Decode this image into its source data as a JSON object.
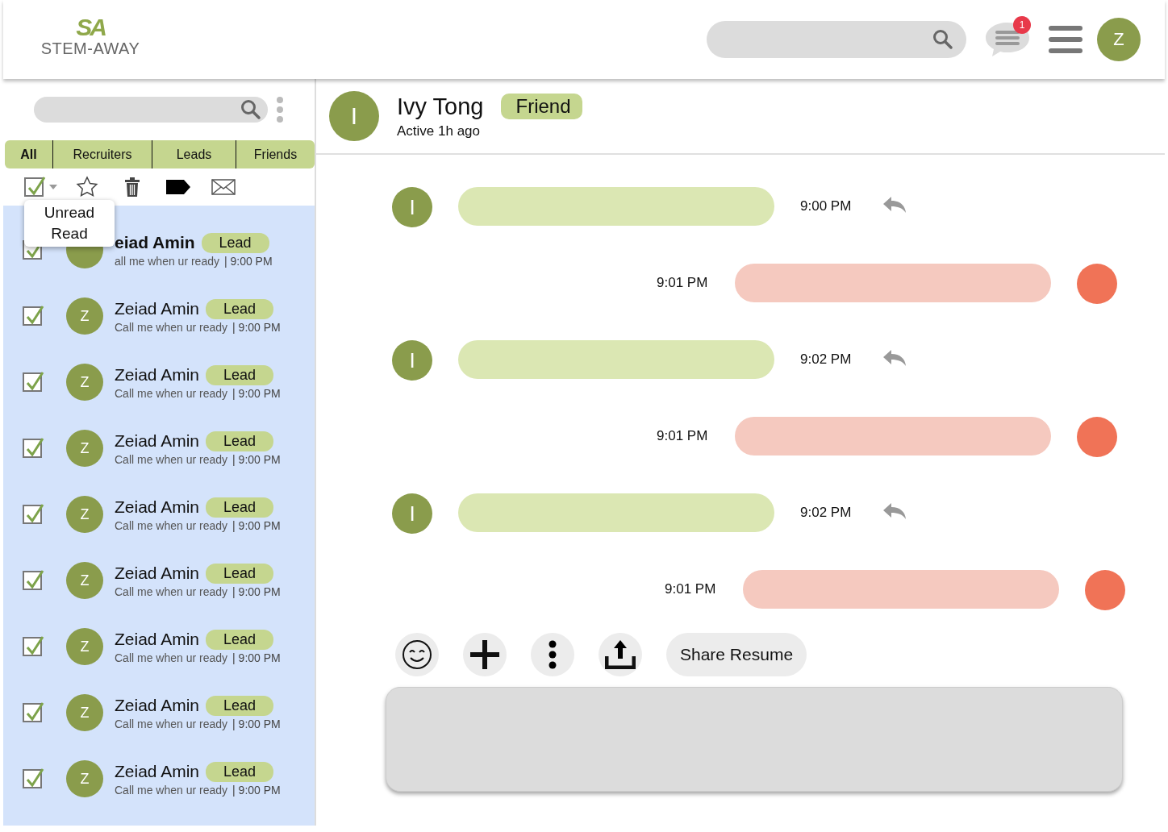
{
  "header": {
    "logo": {
      "initials": "SA",
      "name": "STEM-AWAY"
    },
    "notifications": {
      "badge": "1"
    },
    "user_avatar": "Z"
  },
  "sidebar": {
    "tabs": [
      {
        "label": "All",
        "selected": true
      },
      {
        "label": "Recruiters",
        "selected": false
      },
      {
        "label": "Leads",
        "selected": false
      },
      {
        "label": "Friends",
        "selected": false
      }
    ],
    "select_all_checked": true,
    "select_menu": [
      "Unread",
      "Read"
    ],
    "conversations": [
      {
        "name": "eiad Amin",
        "tag": "Lead",
        "preview": "all me when ur ready",
        "time": "| 9:00 PM",
        "checked": true,
        "unread": true
      },
      {
        "avatar": "Z",
        "name": "Zeiad Amin",
        "tag": "Lead",
        "preview": "Call me when ur ready",
        "time": "| 9:00 PM",
        "checked": true,
        "unread": false
      },
      {
        "avatar": "Z",
        "name": "Zeiad Amin",
        "tag": "Lead",
        "preview": "Call me when ur ready",
        "time": "| 9:00 PM",
        "checked": true,
        "unread": false
      },
      {
        "avatar": "Z",
        "name": "Zeiad Amin",
        "tag": "Lead",
        "preview": "Call me when ur ready",
        "time": "| 9:00 PM",
        "checked": true,
        "unread": false
      },
      {
        "avatar": "Z",
        "name": "Zeiad Amin",
        "tag": "Lead",
        "preview": "Call me when ur ready",
        "time": "| 9:00 PM",
        "checked": true,
        "unread": false
      },
      {
        "avatar": "Z",
        "name": "Zeiad Amin",
        "tag": "Lead",
        "preview": "Call me when ur ready",
        "time": "| 9:00 PM",
        "checked": true,
        "unread": false
      },
      {
        "avatar": "Z",
        "name": "Zeiad Amin",
        "tag": "Lead",
        "preview": "Call me when ur ready",
        "time": "| 9:00 PM",
        "checked": true,
        "unread": false
      },
      {
        "avatar": "Z",
        "name": "Zeiad Amin",
        "tag": "Lead",
        "preview": "Call me when ur ready",
        "time": "| 9:00 PM",
        "checked": true,
        "unread": false
      },
      {
        "avatar": "Z",
        "name": "Zeiad Amin",
        "tag": "Lead",
        "preview": "Call me when ur ready",
        "time": "| 9:00 PM",
        "checked": true,
        "unread": false
      }
    ]
  },
  "chat": {
    "contact": {
      "avatar": "I",
      "name": "Ivy Tong",
      "tag": "Friend",
      "status": "Active 1h ago"
    },
    "messages": [
      {
        "kind": "incoming",
        "avatar": "I",
        "time": "9:00 PM"
      },
      {
        "kind": "outgoing",
        "time": "9:01 PM"
      },
      {
        "kind": "incoming",
        "avatar": "I",
        "time": "9:02 PM"
      },
      {
        "kind": "outgoing",
        "time": "9:01 PM"
      },
      {
        "kind": "incoming",
        "avatar": "I",
        "time": "9:02 PM"
      },
      {
        "kind": "outgoing",
        "time": "9:01 PM"
      }
    ],
    "actions": [
      {
        "kind": "emoji"
      },
      {
        "kind": "add"
      },
      {
        "kind": "more"
      },
      {
        "kind": "upload"
      }
    ],
    "share_button": "Share Resume"
  }
}
